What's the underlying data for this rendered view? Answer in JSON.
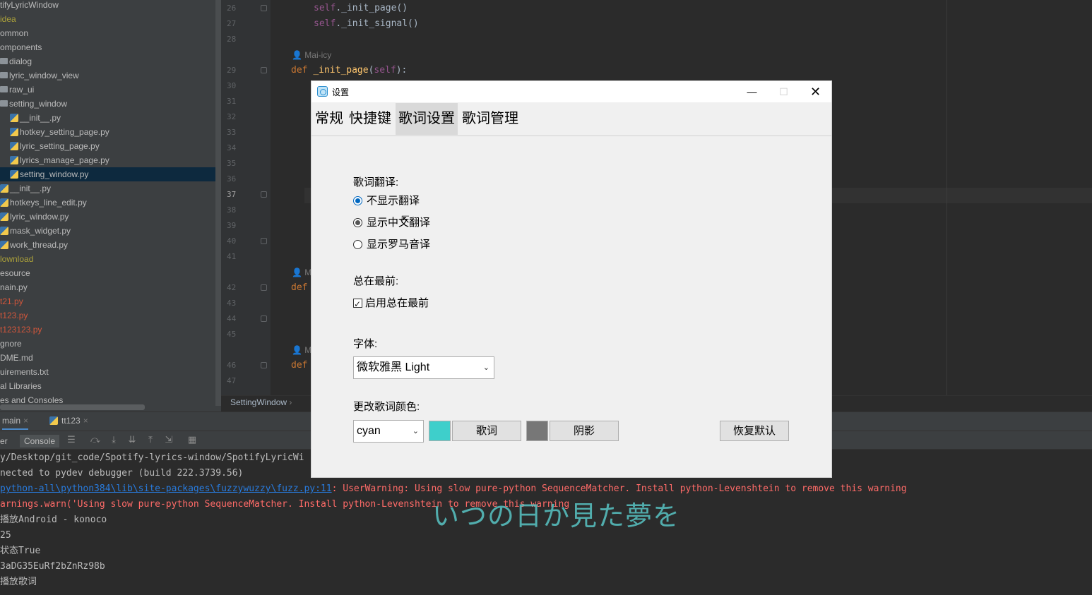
{
  "tree": {
    "items": [
      {
        "label": "tifyLyricWindow",
        "type": "text",
        "color": "#bbbbbb"
      },
      {
        "label": "idea",
        "type": "text",
        "color": "#aaa03a"
      },
      {
        "label": "ommon",
        "type": "text",
        "color": "#bbbbbb"
      },
      {
        "label": "omponents",
        "type": "text",
        "color": "#bbbbbb"
      },
      {
        "label": "dialog",
        "type": "folder",
        "color": "#bbbbbb"
      },
      {
        "label": "lyric_window_view",
        "type": "folder",
        "color": "#bbbbbb"
      },
      {
        "label": "raw_ui",
        "type": "folder",
        "color": "#bbbbbb"
      },
      {
        "label": "setting_window",
        "type": "folder",
        "color": "#bbbbbb"
      },
      {
        "label": "__init__.py",
        "type": "py",
        "color": "#bbbbbb"
      },
      {
        "label": "hotkey_setting_page.py",
        "type": "py",
        "color": "#bbbbbb"
      },
      {
        "label": "lyric_setting_page.py",
        "type": "py",
        "color": "#bbbbbb"
      },
      {
        "label": "lyrics_manage_page.py",
        "type": "py",
        "color": "#bbbbbb"
      },
      {
        "label": "setting_window.py",
        "type": "py",
        "color": "#bbbbbb",
        "selected": true
      },
      {
        "label": "__init__.py",
        "type": "py",
        "color": "#bbbbbb"
      },
      {
        "label": "hotkeys_line_edit.py",
        "type": "py",
        "color": "#bbbbbb"
      },
      {
        "label": "lyric_window.py",
        "type": "py",
        "color": "#bbbbbb"
      },
      {
        "label": "mask_widget.py",
        "type": "py",
        "color": "#bbbbbb"
      },
      {
        "label": "work_thread.py",
        "type": "py",
        "color": "#bbbbbb"
      },
      {
        "label": "lownload",
        "type": "text",
        "color": "#aaa03a"
      },
      {
        "label": "esource",
        "type": "text",
        "color": "#bbbbbb"
      },
      {
        "label": "nain.py",
        "type": "text",
        "color": "#bbbbbb"
      },
      {
        "label": "t21.py",
        "type": "text",
        "color": "#d2563b"
      },
      {
        "label": "t123.py",
        "type": "text",
        "color": "#d2563b"
      },
      {
        "label": "t123123.py",
        "type": "text",
        "color": "#d2563b"
      },
      {
        "label": "gnore",
        "type": "text",
        "color": "#bbbbbb"
      },
      {
        "label": "DME.md",
        "type": "text",
        "color": "#bbbbbb"
      },
      {
        "label": "uirements.txt",
        "type": "text",
        "color": "#bbbbbb"
      },
      {
        "label": "al Libraries",
        "type": "text",
        "color": "#bbbbbb"
      },
      {
        "label": "es and Consoles",
        "type": "text",
        "color": "#bbbbbb"
      }
    ]
  },
  "editor": {
    "line_numbers": [
      "26",
      "27",
      "28",
      "29",
      "30",
      "31",
      "32",
      "33",
      "34",
      "35",
      "36",
      "37",
      "38",
      "39",
      "40",
      "41",
      "42",
      "43",
      "44",
      "45",
      "46",
      "47"
    ],
    "current_line": "37",
    "line1": "self._init_page()",
    "line2": "self._init_signal()",
    "author_hint": "Mai-icy",
    "author_hint_short": "M",
    "def_kw": "def",
    "def_line_name": "_init_page",
    "def_line_args": "(self):",
    "breadcrumb": "SettingWindow"
  },
  "run": {
    "tabs": [
      {
        "label": "main",
        "active": true
      },
      {
        "label": "tt123",
        "active": false
      }
    ],
    "toolbar": {
      "left_label": "er",
      "console_label": "Console"
    },
    "console": [
      {
        "text": "y/Desktop/git_code/Spotify-lyrics-window/SpotifyLyricWi",
        "kind": "normal"
      },
      {
        "text": "nected to pydev debugger (build 222.3739.56)",
        "kind": "normal"
      },
      {
        "link": "python-all\\python384\\lib\\site-packages\\fuzzywuzzy\\fuzz.py:11",
        "text": ": UserWarning: Using slow pure-python SequenceMatcher. Install python-Levenshtein to remove this warning",
        "kind": "err"
      },
      {
        "text": "arnings.warn('Using slow pure-python SequenceMatcher. Install python-Levenshtein to remove this warning",
        "kind": "err"
      },
      {
        "text": "播放Android - konoco",
        "kind": "normal"
      },
      {
        "text": "25",
        "kind": "normal"
      },
      {
        "text": "状态True",
        "kind": "normal"
      },
      {
        "text": "3aDG35EuRf2bZnRz98b",
        "kind": "normal"
      },
      {
        "text": "播放歌词",
        "kind": "normal"
      }
    ]
  },
  "lyric_overlay": {
    "text": "いつの日か見た夢を",
    "color": "#58c4c4"
  },
  "dialog": {
    "title": "设置",
    "nav": [
      "常规",
      "快捷键",
      "歌词设置",
      "歌词管理"
    ],
    "nav_active_index": 2,
    "translation": {
      "label": "歌词翻译:",
      "options": [
        "不显示翻译",
        "显示中文翻译",
        "显示罗马音译"
      ],
      "selected_index": 0
    },
    "on_top": {
      "label": "总在最前:",
      "checkbox_label": "启用总在最前",
      "checked": true
    },
    "font": {
      "label": "字体:",
      "value": "微软雅黑 Light"
    },
    "color": {
      "label": "更改歌词颜色:",
      "select_value": "cyan",
      "lyric_color": "#3ecfcb",
      "lyric_button": "歌词",
      "shadow_color": "#777777",
      "shadow_button": "阴影",
      "reset_button": "恢复默认"
    }
  }
}
